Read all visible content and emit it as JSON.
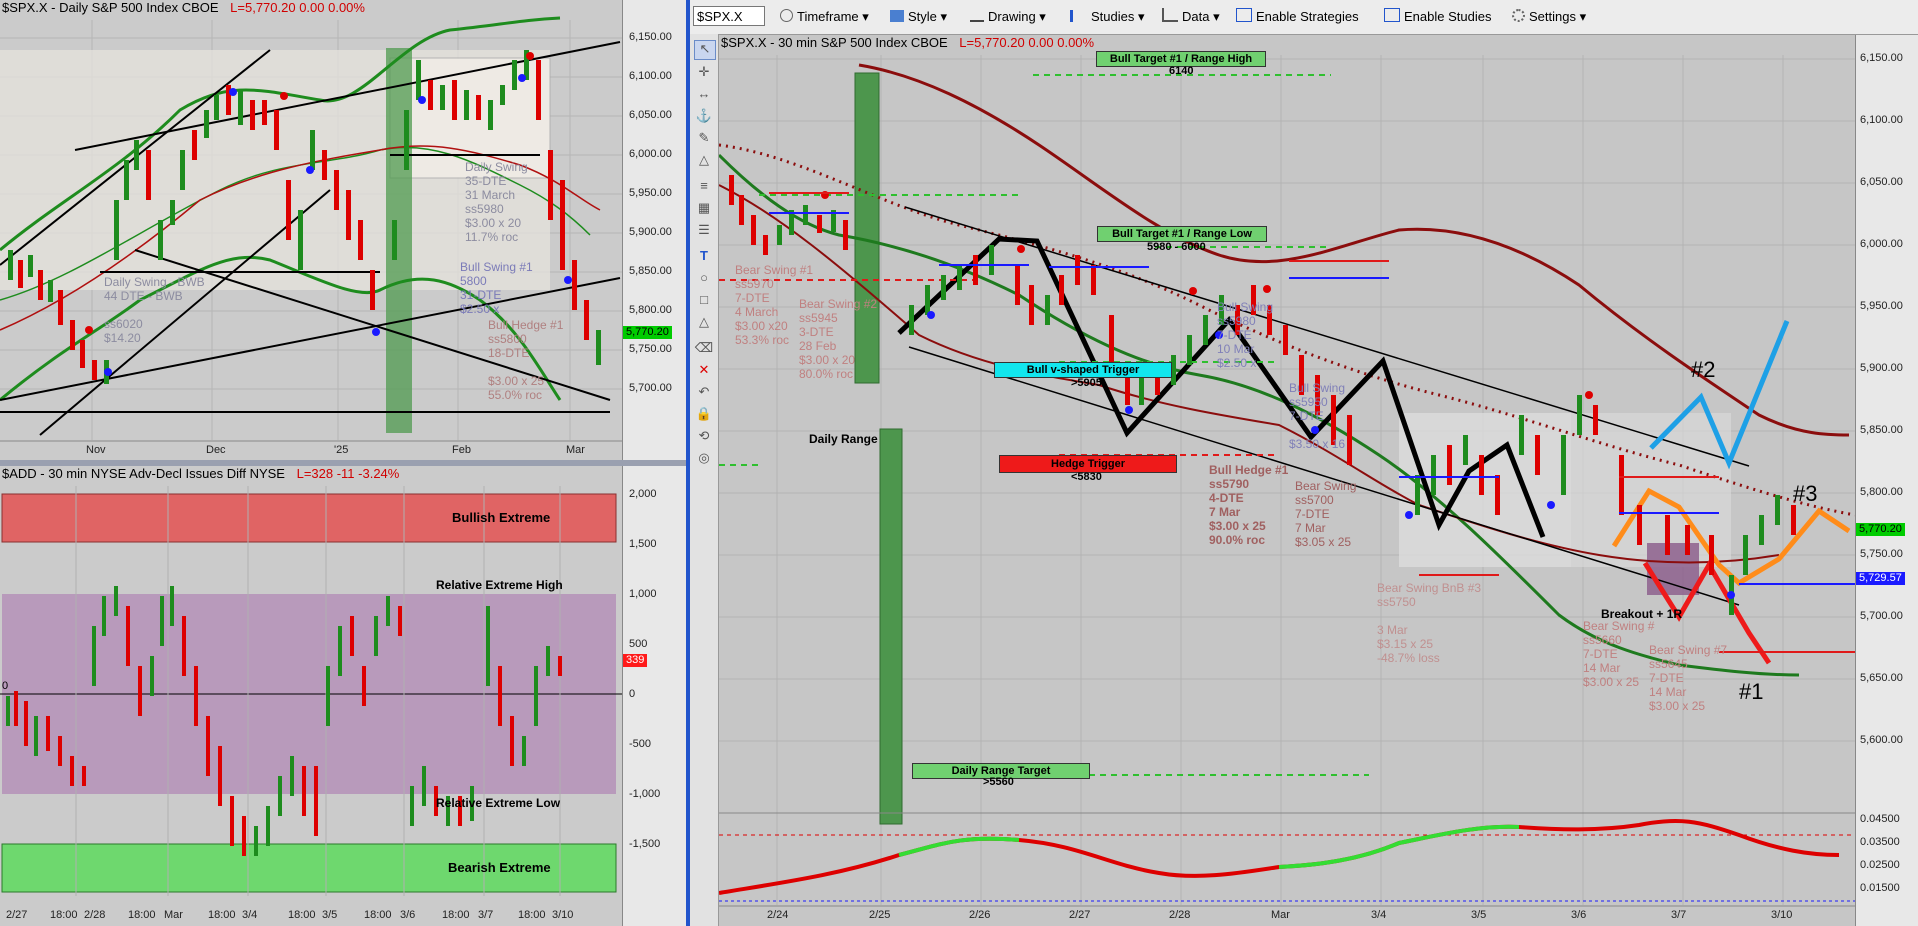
{
  "left_top": {
    "header": {
      "symbol": "$SPX.X - Daily  S&P 500 Index  CBOE",
      "last": "L=5,770.20  0.00  0.00%"
    },
    "y_ticks": [
      "6,150.00",
      "6,100.00",
      "6,050.00",
      "6,000.00",
      "5,950.00",
      "5,900.00",
      "5,850.00",
      "5,800.00",
      "5,750.00",
      "5,700.00"
    ],
    "x_ticks": [
      "Nov",
      "Dec",
      "'25",
      "Feb",
      "Mar"
    ],
    "price_box": "5,770.20",
    "annotations": {
      "daily_swing_1": "Daily Swing\n35-DTE\n31 March\nss5980\n$3.00 x 20\n11.7% roc",
      "bull_swing": "Bull Swing #1\n5800\n31-DTE\n$2.50 x\n",
      "daily_swing_bwb": "Daily Swing - BWB\n44 DTE - BWB\n\nss6020\n$14.20",
      "bull_hedge": "Bull Hedge #1\nss5800\n18-DTE\n\n$3.00 x 25\n55.0% roc"
    }
  },
  "left_bottom": {
    "header": {
      "symbol": "$ADD - 30 min  NYSE Adv-Decl Issues Diff  NYSE",
      "last": "L=328  -11  -3.24%"
    },
    "y_ticks": [
      "2,000",
      "1,500",
      "1,000",
      "500",
      "0",
      "-500",
      "-1,000",
      "-1,500"
    ],
    "x_ticks": [
      "2/27",
      "18:00",
      "2/28",
      "18:00",
      "Mar",
      "18:00",
      "3/4",
      "18:00",
      "3/5",
      "18:00",
      "3/6",
      "18:00",
      "3/7",
      "18:00",
      "3/10"
    ],
    "value_box": "339",
    "zero_label": "0",
    "zones": {
      "bullish": "Bullish Extreme",
      "rel_high": "Relative Extreme High",
      "rel_low": "Relative Extreme Low",
      "bearish": "Bearish Extreme"
    }
  },
  "toolbar": {
    "symbol": "$SPX.X",
    "items": [
      "Timeframe",
      "Style",
      "Drawing",
      "Studies",
      "Data",
      "Enable Strategies",
      "Enable Studies",
      "Settings"
    ]
  },
  "right": {
    "header": {
      "symbol": "$SPX.X - 30 min  S&P 500 Index  CBOE",
      "last": "L=5,770.20  0.00  0.00%"
    },
    "y_ticks": [
      "6,150.00",
      "6,100.00",
      "6,050.00",
      "6,000.00",
      "5,950.00",
      "5,900.00",
      "5,850.00",
      "5,800.00",
      "5,750.00",
      "5,700.00",
      "5,650.00",
      "5,600.00"
    ],
    "y_ticks_lower": [
      "0.04500",
      "0.03500",
      "0.02500",
      "0.01500"
    ],
    "x_ticks": [
      "2/24",
      "2/25",
      "2/26",
      "2/27",
      "2/28",
      "Mar",
      "3/4",
      "3/5",
      "3/6",
      "3/7",
      "3/10"
    ],
    "price_box": "5,770.20",
    "price_box2": "5,729.57",
    "banners": {
      "bull_target_high": "Bull Target #1 / Range High",
      "bull_target_high_val": "6140",
      "bull_target_low": "Bull Target #1 / Range Low",
      "bull_target_low_val": "5980 - 6000",
      "v_trigger": "Bull v-shaped Trigger",
      "v_trigger_val": ">5905",
      "hedge_trigger": "Hedge Trigger",
      "hedge_trigger_val": "<5830",
      "daily_range_target": "Daily Range Target",
      "daily_range_target_val": ">5560",
      "daily_range": "Daily Range",
      "breakout": "Breakout + 1R"
    },
    "scenario_labels": {
      "one": "#1",
      "two": "#2",
      "three": "#3"
    },
    "notes": {
      "bear_swing_1": "Bear Swing #1\nss5970\n7-DTE\n4 March\n$3.00 x20\n53.3% roc",
      "bear_swing_2": "Bear Swing #2\nss5945\n3-DTE\n28 Feb\n$3.00 x 20\n80.0% roc",
      "bull_hedge": "Bull Hedge #1\nss5790\n4-DTE\n7 Mar\n$3.00 x 25\n90.0% roc",
      "bull_swing_a": "Bull Swing\nss5980\n7-DTE\n10 Mar\n$2.50 x",
      "bull_swing_b": "Bull Swing\nss5950\n7-DTE\n\n$3.50 x 16",
      "bear_swing_c": "Bear Swing\nss5700\n7-DTE\n7 Mar\n$3.05 x 25",
      "bear_swing_bnb": "Bear Swing BnB #3\nss5750\n\n3 Mar\n$3.15 x 25\n-48.7% loss",
      "bear_swing_d": "Bear Swing #\nss5660\n7-DTE\n14 Mar\n$3.00 x 25",
      "bear_swing_e": "Bear Swing #7\nss5645\n7-DTE\n14 Mar\n$3.00 x 25"
    }
  },
  "colors": {
    "bull": "#1e8c1e",
    "bear": "#dd0000",
    "accent": "#00a0e0",
    "orange": "#ff8c1a"
  }
}
